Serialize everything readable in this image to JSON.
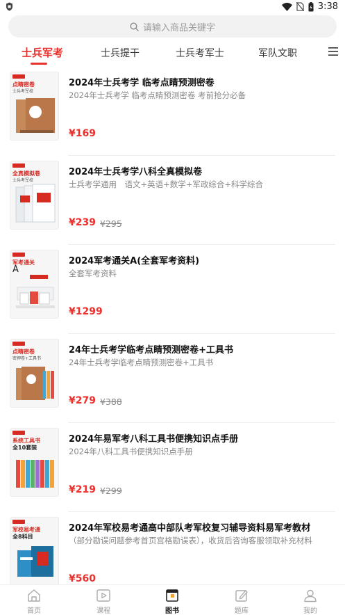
{
  "status_bar": {
    "time": "3:38"
  },
  "search": {
    "placeholder": "请输入商品关键字"
  },
  "tabs": [
    {
      "label": "士兵军考",
      "active": true
    },
    {
      "label": "士兵提干",
      "active": false
    },
    {
      "label": "士兵考军士",
      "active": false
    },
    {
      "label": "军队文职",
      "active": false
    }
  ],
  "colors": {
    "accent": "#e8322e",
    "muted": "#888888"
  },
  "products": [
    {
      "cover_title": "点睛密卷",
      "cover_subtitle": "士兵考军校",
      "title": "2024年士兵考学 临考点睛预测密卷",
      "subtitle": "2024年士兵考学 临考点睛预测密卷 考前抢分必备",
      "price": "¥169",
      "original_price": ""
    },
    {
      "cover_title": "全真模拟卷",
      "cover_subtitle": "士兵考军校",
      "title": "2024年士兵考学八科全真模拟卷",
      "subtitle": "士兵考学通用　语文+英语+数学+军政综合+科学综合",
      "price": "¥239",
      "original_price": "¥295"
    },
    {
      "cover_title": "军考通关",
      "cover_subtitle": "A",
      "title": "2024军考通关A(全套军考资料)",
      "subtitle": "全套军考资料",
      "price": "¥1299",
      "original_price": ""
    },
    {
      "cover_title": "点睛密卷",
      "cover_subtitle": "密押卷+工具书",
      "title": "24年士兵考学临考点睛预测密卷+工具书",
      "subtitle": "24年士兵考学临考点睛预测密卷+工具书",
      "price": "¥279",
      "original_price": "¥388"
    },
    {
      "cover_title": "系统工具书",
      "cover_subtitle": "全10套装",
      "title": "2024年易军考八科工具书便携知识点手册",
      "subtitle": "2024年八科工具书便携知识点手册",
      "price": "¥219",
      "original_price": "¥299"
    },
    {
      "cover_title": "军校易考通",
      "cover_subtitle": "全8科目",
      "title": "2024年军校易考通高中部队考军校复习辅导资料易军考教材",
      "subtitle": "（部分勘误问题参考首页宫格勘误表），收货后咨询客服领取补充材料",
      "price": "¥560",
      "original_price": ""
    }
  ],
  "bottom_nav": [
    {
      "label": "首页",
      "icon": "home-icon",
      "active": false
    },
    {
      "label": "课程",
      "icon": "play-icon",
      "active": false
    },
    {
      "label": "图书",
      "icon": "book-icon",
      "active": true
    },
    {
      "label": "题库",
      "icon": "edit-icon",
      "active": false
    },
    {
      "label": "我的",
      "icon": "user-icon",
      "active": false
    }
  ]
}
